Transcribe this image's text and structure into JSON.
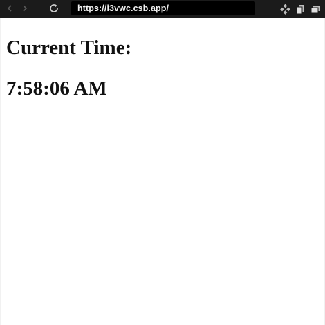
{
  "browser": {
    "url": "https://i3vwc.csb.app/",
    "back_icon": "arrow-left-icon",
    "forward_icon": "arrow-right-icon",
    "reload_icon": "reload-icon",
    "extension_icons": [
      "extensions-icon",
      "copy-icon",
      "tabs-icon"
    ]
  },
  "page": {
    "heading": "Current Time:",
    "time": "7:58:06 AM"
  }
}
